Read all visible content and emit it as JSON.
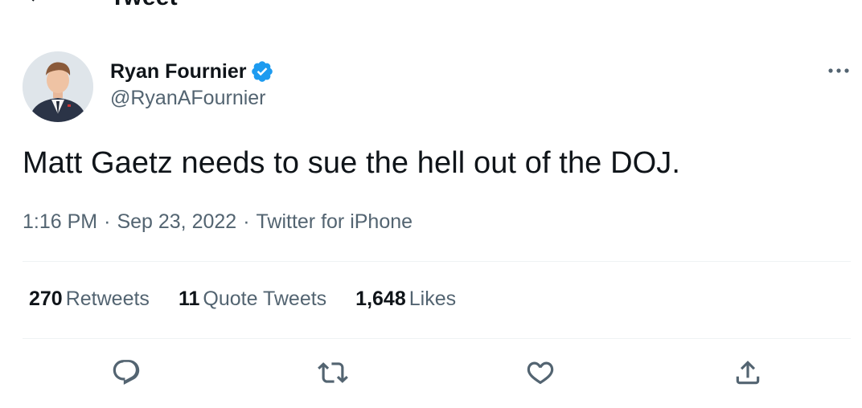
{
  "header": {
    "title": "Tweet",
    "back_icon": "arrow-left-icon"
  },
  "author": {
    "display_name": "Ryan Fournier",
    "handle": "@RyanAFournier",
    "verified": true,
    "verified_color": "#1d9bf0"
  },
  "tweet": {
    "text": "Matt Gaetz needs to sue the hell out of the DOJ.",
    "time": "1:16 PM",
    "date": "Sep 23, 2022",
    "source": "Twitter for iPhone",
    "separator": "·"
  },
  "stats": {
    "retweets": {
      "count": "270",
      "label": "Retweets"
    },
    "quote_tweets": {
      "count": "11",
      "label": "Quote Tweets"
    },
    "likes": {
      "count": "1,648",
      "label": "Likes"
    }
  },
  "actions": [
    "reply-icon",
    "retweet-icon",
    "like-icon",
    "share-icon"
  ],
  "colors": {
    "text_primary": "#0f1419",
    "text_secondary": "#536471",
    "divider": "#eff3f4",
    "icon": "#536471"
  }
}
